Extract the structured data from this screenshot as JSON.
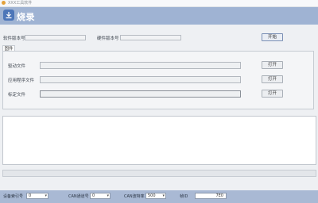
{
  "window": {
    "title": "XXX工具软件"
  },
  "header": {
    "title": "烧录"
  },
  "top": {
    "software_version_label": "软件版本号",
    "software_version_value": "",
    "hardware_version_label": "硬件版本号",
    "hardware_version_value": "",
    "start_button": "开始"
  },
  "tabs": [
    {
      "label": "固件"
    }
  ],
  "files": [
    {
      "label": "驱动文件",
      "value": "",
      "button": "打开"
    },
    {
      "label": "应用程序文件",
      "value": "",
      "button": "打开"
    },
    {
      "label": "标定文件",
      "value": "",
      "button": "打开"
    }
  ],
  "log": {
    "text": ""
  },
  "progress": {
    "percent": 0
  },
  "status": {
    "device_index_label": "设备索引号",
    "device_index_value": "0",
    "can_channel_label": "CAN通道号",
    "can_channel_value": "0",
    "can_baud_label": "CAN波特率",
    "can_baud_value": "500",
    "frame_id_label": "帧ID",
    "frame_id_value": "7E0"
  },
  "colors": {
    "header": "#9fb3d3",
    "statusbar": "#a9b9d4",
    "progress": "#4e9a5f"
  }
}
